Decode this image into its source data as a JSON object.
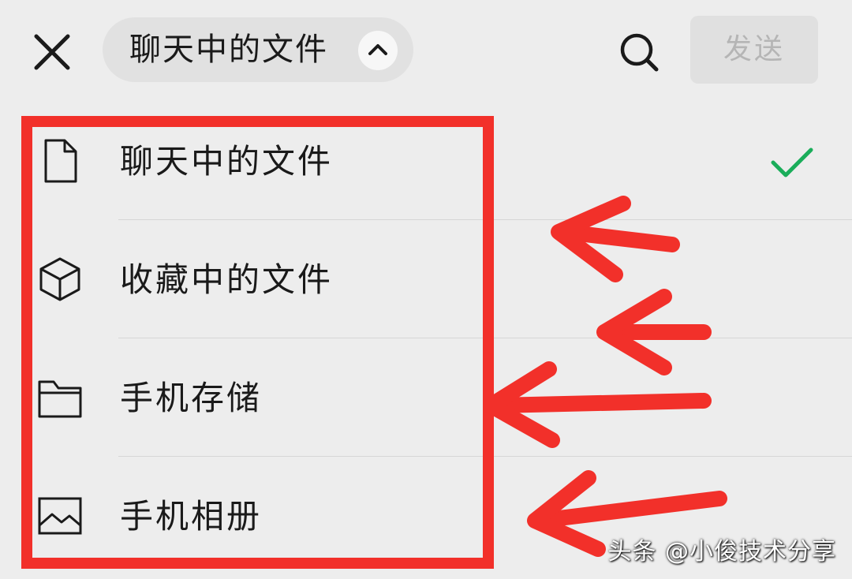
{
  "header": {
    "close_icon": "close-icon",
    "selector_label": "聊天中的文件",
    "selector_chevron_icon": "chevron-up-icon",
    "search_icon": "search-icon",
    "send_label": "发送"
  },
  "menu": {
    "items": [
      {
        "label": "聊天中的文件",
        "icon": "document-icon",
        "selected": true
      },
      {
        "label": "收藏中的文件",
        "icon": "cube-icon",
        "selected": false
      },
      {
        "label": "手机存储",
        "icon": "folder-icon",
        "selected": false
      },
      {
        "label": "手机相册",
        "icon": "image-icon",
        "selected": false
      }
    ],
    "check_icon": "check-icon"
  },
  "annotation": {
    "highlight_color": "#f2302a",
    "arrow_count": 4
  },
  "watermark": "头条 @小俊技术分享",
  "colors": {
    "background": "#ededed",
    "check": "#1aad5a",
    "send_disabled_text": "#b5b5b5"
  }
}
